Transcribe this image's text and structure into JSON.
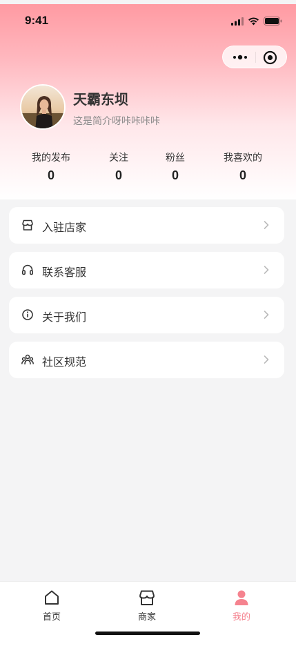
{
  "status_bar": {
    "time": "9:41"
  },
  "profile": {
    "name": "天霸东坝",
    "bio": "这是简介呀咔咔咔咔"
  },
  "stats": [
    {
      "label": "我的发布",
      "value": "0"
    },
    {
      "label": "关注",
      "value": "0"
    },
    {
      "label": "粉丝",
      "value": "0"
    },
    {
      "label": "我喜欢的",
      "value": "0"
    }
  ],
  "menu": [
    {
      "label": "入驻店家",
      "icon": "store-icon"
    },
    {
      "label": "联系客服",
      "icon": "headset-icon"
    },
    {
      "label": "关于我们",
      "icon": "info-icon"
    },
    {
      "label": "社区规范",
      "icon": "community-icon"
    }
  ],
  "tabbar": [
    {
      "label": "首页",
      "icon": "home-icon",
      "active": false
    },
    {
      "label": "商家",
      "icon": "shop-icon",
      "active": false
    },
    {
      "label": "我的",
      "icon": "user-icon",
      "active": true
    }
  ],
  "colors": {
    "accent": "#f5838f",
    "header_top": "#ff9aa2",
    "page_background": "#f4f4f5"
  }
}
